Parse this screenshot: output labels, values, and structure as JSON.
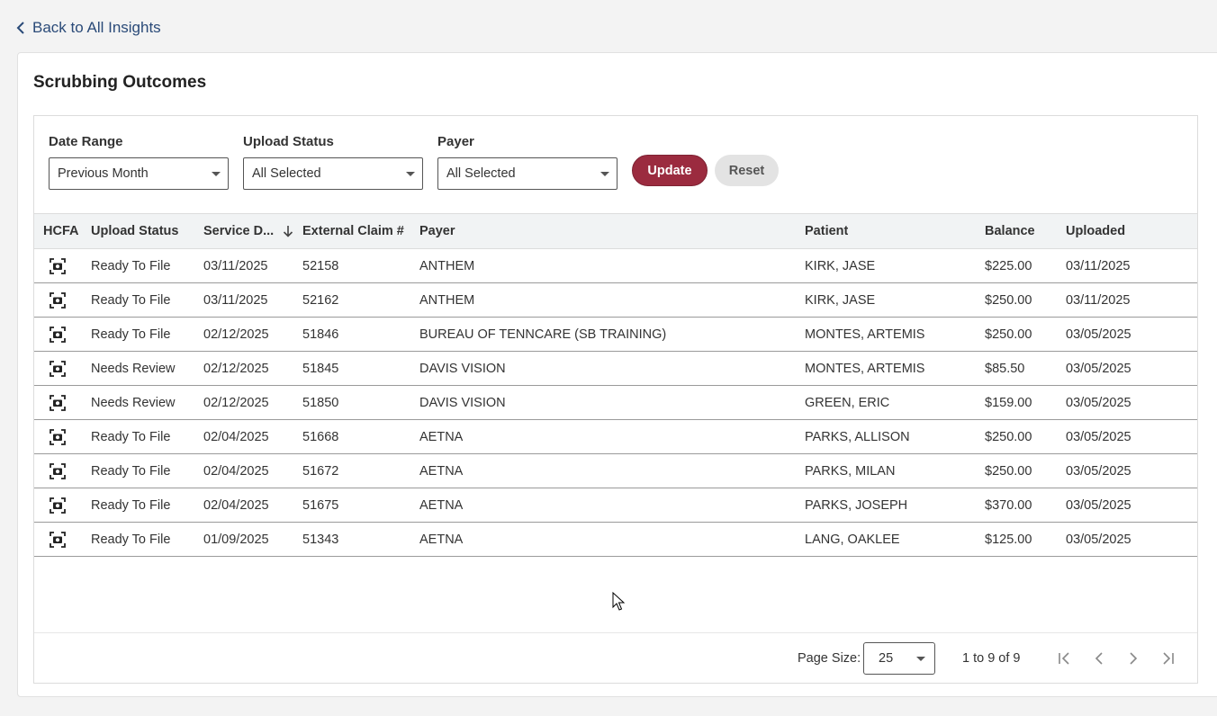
{
  "back_link": {
    "label": "Back to All Insights",
    "icon": "chevron-left-icon"
  },
  "card": {
    "title": "Scrubbing Outcomes"
  },
  "filters": {
    "date_range": {
      "label": "Date Range",
      "value": "Previous Month"
    },
    "upload_status": {
      "label": "Upload Status",
      "value": "All Selected"
    },
    "payer": {
      "label": "Payer",
      "value": "All Selected"
    }
  },
  "buttons": {
    "update": "Update",
    "reset": "Reset"
  },
  "colors": {
    "primary": "#9b2b3f",
    "link": "#2a4a78",
    "header_bg": "#f1f3f4"
  },
  "table": {
    "columns": [
      "HCFA",
      "Upload Status",
      "Service D...",
      "External Claim #",
      "Payer",
      "Patient",
      "Balance",
      "Uploaded"
    ],
    "sorted_column": "Service D...",
    "sort_direction": "descending",
    "rows": [
      {
        "status": "Ready To File",
        "service_date": "03/11/2025",
        "claim": "52158",
        "payer": "ANTHEM",
        "patient": "KIRK, JASE",
        "balance": "$225.00",
        "uploaded": "03/11/2025"
      },
      {
        "status": "Ready To File",
        "service_date": "03/11/2025",
        "claim": "52162",
        "payer": "ANTHEM",
        "patient": "KIRK, JASE",
        "balance": "$250.00",
        "uploaded": "03/11/2025"
      },
      {
        "status": "Ready To File",
        "service_date": "02/12/2025",
        "claim": "51846",
        "payer": "BUREAU OF TENNCARE (SB TRAINING)",
        "patient": "MONTES, ARTEMIS",
        "balance": "$250.00",
        "uploaded": "03/05/2025"
      },
      {
        "status": "Needs Review",
        "service_date": "02/12/2025",
        "claim": "51845",
        "payer": "DAVIS VISION",
        "patient": "MONTES, ARTEMIS",
        "balance": "$85.50",
        "uploaded": "03/05/2025"
      },
      {
        "status": "Needs Review",
        "service_date": "02/12/2025",
        "claim": "51850",
        "payer": "DAVIS VISION",
        "patient": "GREEN, ERIC",
        "balance": "$159.00",
        "uploaded": "03/05/2025"
      },
      {
        "status": "Ready To File",
        "service_date": "02/04/2025",
        "claim": "51668",
        "payer": "AETNA",
        "patient": "PARKS, ALLISON",
        "balance": "$250.00",
        "uploaded": "03/05/2025"
      },
      {
        "status": "Ready To File",
        "service_date": "02/04/2025",
        "claim": "51672",
        "payer": "AETNA",
        "patient": "PARKS, MILAN",
        "balance": "$250.00",
        "uploaded": "03/05/2025"
      },
      {
        "status": "Ready To File",
        "service_date": "02/04/2025",
        "claim": "51675",
        "payer": "AETNA",
        "patient": "PARKS, JOSEPH",
        "balance": "$370.00",
        "uploaded": "03/05/2025"
      },
      {
        "status": "Ready To File",
        "service_date": "01/09/2025",
        "claim": "51343",
        "payer": "AETNA",
        "patient": "LANG, OAKLEE",
        "balance": "$125.00",
        "uploaded": "03/05/2025"
      }
    ]
  },
  "pagination": {
    "page_size_label": "Page Size:",
    "page_size": "25",
    "range": "1 to 9 of 9"
  }
}
